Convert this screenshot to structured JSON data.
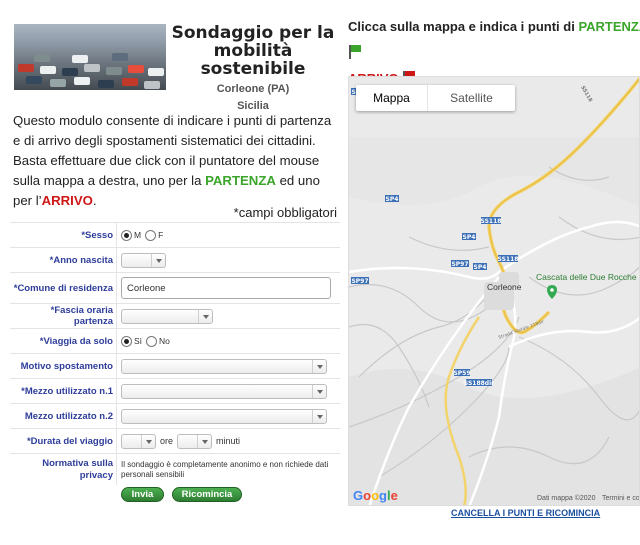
{
  "header": {
    "title_line1": "Sondaggio per la",
    "title_line2": "mobilità sostenibile",
    "location": "Corleone (PA)",
    "region": "Sicilia"
  },
  "intro": {
    "text_before": "Questo modulo consente di indicare i punti di partenza e di arrivo degli spostamenti sistematici dei cittadini. Basta effettuare due click con il puntatore del mouse sulla mappa a destra, uno per la ",
    "partenza": "PARTENZA",
    "text_mid": " ed uno per l’",
    "arrivo": "ARRIVO",
    "text_end": "."
  },
  "required_note": "*campi obbligatori",
  "form": {
    "sesso": {
      "label": "*Sesso",
      "opt_m": "M",
      "opt_f": "F",
      "selected": "M"
    },
    "anno": {
      "label": "*Anno nascita"
    },
    "comune": {
      "label": "*Comune di residenza",
      "value": "Corleone"
    },
    "fascia": {
      "label": "*Fascia oraria partenza"
    },
    "solo": {
      "label": "*Viaggia da solo",
      "opt_si": "Sì",
      "opt_no": "No",
      "selected": "Sì"
    },
    "motivo": {
      "label": "Motivo spostamento"
    },
    "mezzo1": {
      "label": "*Mezzo utilizzato n.1"
    },
    "mezzo2": {
      "label": "Mezzo utilizzato n.2"
    },
    "durata": {
      "label": "*Durata del viaggio",
      "ore": "ore",
      "minuti": "minuti"
    },
    "privacy": {
      "label_line1": "Normativa sulla",
      "label_line2": "privacy",
      "text": "Il sondaggio è completamente anonimo e non richiede dati personali sensibili"
    }
  },
  "buttons": {
    "invia": "Invia",
    "ricomincia": "Ricomincia"
  },
  "instructions": {
    "text": "Clicca sulla mappa e indica i punti di ",
    "partenza": "PARTENZA",
    "arrivo": "ARRIVO",
    "flag_green": "#3aa52a",
    "flag_red": "#d01717"
  },
  "map": {
    "toggle_map": "Mappa",
    "toggle_sat": "Satellite",
    "labels": {
      "town": "Corleone",
      "poi": "Cascata delle Due Rocche",
      "road1": "SP4",
      "road2": "SS118",
      "road3": "SP97",
      "road4": "SP59",
      "road5": "SS188dir",
      "road6": "Strada Statale 118dir",
      "road7": "SS118",
      "road8": "SP4",
      "road9": "SS118",
      "road10": "SP97",
      "road11": "SP4",
      "road12": "SP4"
    },
    "google": [
      "G",
      "o",
      "o",
      "g",
      "l",
      "e"
    ],
    "attribution": "Dati mappa ©2020",
    "terms": "Termini e co"
  },
  "cancel_link": "CANCELLA I PUNTI E RICOMINCIA"
}
